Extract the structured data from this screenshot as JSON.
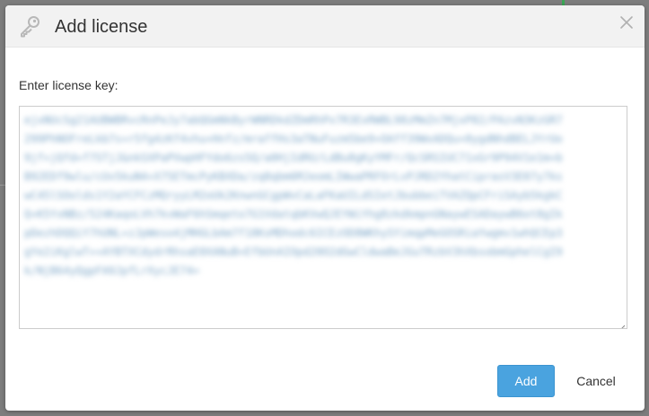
{
  "dialog": {
    "title": "Add license",
    "close_label": "×",
    "key_icon": "key-icon",
    "close_icon": "close-icon"
  },
  "form": {
    "label": "Enter license key:",
    "license_key_value": "ejxNUcSg21AUBWBRvcRnPeJy7abQGmNkByrWNRDkdZDmRhPx7R3ExRWBL98zMmZn7MjxP82/PAzvN3KzGR7299PhNOFreLkb7s+r5fg4zKf4vhu+Hnfz/mraffHs3aTNuFuzm5be9+OAff39WxADQu+0ygdNhdBELJYrUo9jf+jQfd+f7STjJ&nkSXPaPVwpHFYdo6zs5Q/a0HjIdRU/LdBu8gKyYMFr/QcSRSIUC71xGr9P94V1e1m+bB92EDf9wlu/cUv5kuN4+X75ETmcPyKBXDa/zq8qbm6MJeomLIWwaPRFOrLvPJRD2YhatCiprasV3E07y7kswC45lSOolds1Y2aYCFCzMQryyLM2oUk2KnwnGCgpWvCaLaFKaUILdSIetJbubbeiTVAZQpCFriSAyb5kgkCQ+K5YxNBz/524KaqoLVh7kvWaF6hSmqeto7G1VdatqbKVwQJEYWiYhg8zkdkmpnGNaywESADaywB6ot8gIkpDezhDQQiY7hUNL+zJpWeso4jMHGLbAm7f18KsMDhodc6ICEzOD8WKhySYimqpMeGOSRiaYwgmv1whQCEp3gYe2iKglwT++AYBTXCdydrRhsaE0XANuB+EfbUnAIOpd20O2dGwCldwaBeJGuTRzbV3hXbsobmGphelCgI9k/NjB64yQgpFA9JpfLrXycJE74="
  },
  "footer": {
    "add_label": "Add",
    "cancel_label": "Cancel"
  },
  "colors": {
    "primary_button": "#4aa3df",
    "header_bg": "#f2f2f2",
    "key_text": "#7fa8c9"
  }
}
